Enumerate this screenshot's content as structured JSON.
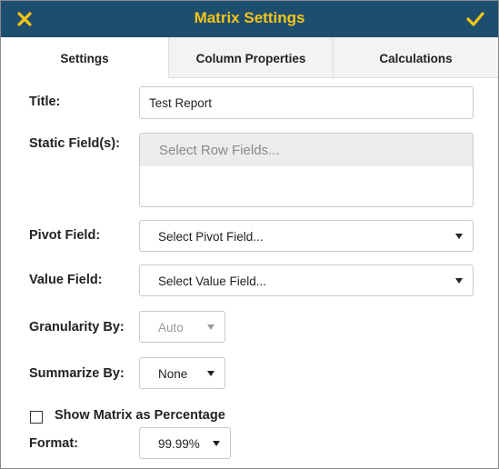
{
  "header": {
    "title": "Matrix Settings",
    "close_icon": "close-icon",
    "confirm_icon": "checkmark-icon",
    "background_color": "#1e4e6e",
    "accent_color": "#f5c518"
  },
  "tabs": [
    {
      "label": "Settings",
      "active": true
    },
    {
      "label": "Column Properties",
      "active": false
    },
    {
      "label": "Calculations",
      "active": false
    }
  ],
  "form": {
    "title": {
      "label": "Title:",
      "value": "Test Report"
    },
    "static_fields": {
      "label": "Static Field(s):",
      "placeholder": "Select Row Fields..."
    },
    "pivot_field": {
      "label": "Pivot Field:",
      "value": "Select Pivot Field..."
    },
    "value_field": {
      "label": "Value Field:",
      "value": "Select Value Field..."
    },
    "granularity": {
      "label": "Granularity By:",
      "value": "Auto",
      "disabled": true
    },
    "summarize": {
      "label": "Summarize By:",
      "value": "None"
    },
    "show_percentage": {
      "label": "Show Matrix as Percentage",
      "checked": false
    },
    "format": {
      "label": "Format:",
      "value": "99.99%"
    }
  }
}
